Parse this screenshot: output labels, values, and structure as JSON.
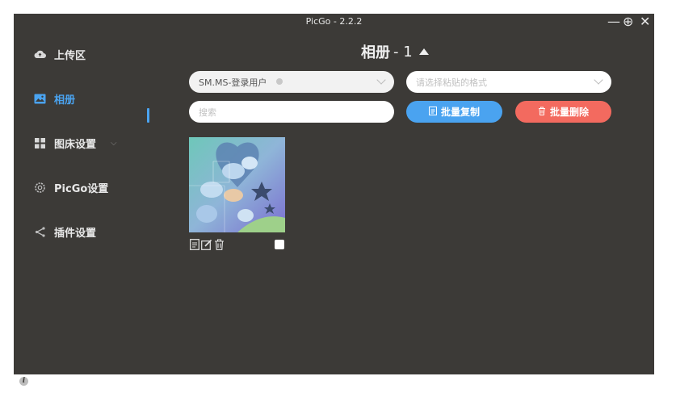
{
  "window": {
    "title": "PicGo - 2.2.2"
  },
  "controls": {
    "minimize": "—",
    "pin": "⊕",
    "close": "✕"
  },
  "sidebar": {
    "items": [
      {
        "label": "上传区",
        "icon": "cloud-upload-icon"
      },
      {
        "label": "相册",
        "icon": "picture-icon"
      },
      {
        "label": "图床设置",
        "icon": "grid-icon"
      },
      {
        "label": "PicGo设置",
        "icon": "gear-icon"
      },
      {
        "label": "插件设置",
        "icon": "share-icon"
      }
    ],
    "chevron": "⌵",
    "info": "i"
  },
  "main": {
    "heading": {
      "name": "相册",
      "count": "- 1"
    },
    "filter": {
      "uploader_value": "SM.MS-登录用户",
      "format_placeholder": "请选择粘贴的格式"
    },
    "search": {
      "placeholder": "搜索"
    },
    "buttons": {
      "copy_label": "批量复制",
      "delete_label": "批量删除"
    },
    "accent": "#4aa3f0",
    "danger": "#f36a5f",
    "gallery": {
      "items": [
        {
          "icons": [
            "copy-icon",
            "edit-icon",
            "delete-icon"
          ],
          "checked": false
        }
      ]
    }
  }
}
